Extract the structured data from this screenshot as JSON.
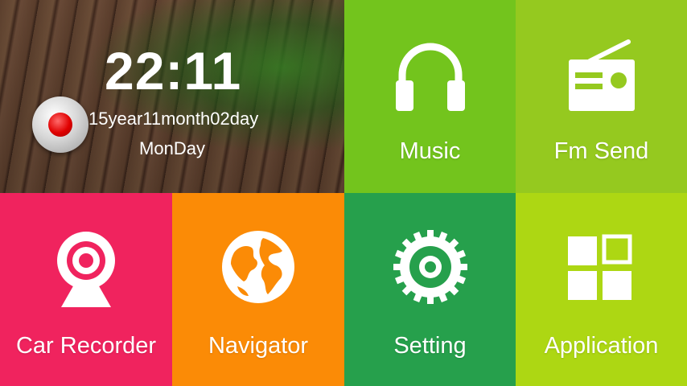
{
  "clock": {
    "time": "22:11",
    "date": "15year11month02day",
    "weekday": "MonDay"
  },
  "tiles": {
    "music": "Music",
    "fm_send": "Fm Send",
    "car_recorder": "Car Recorder",
    "navigator": "Navigator",
    "setting": "Setting",
    "application": "Application"
  },
  "colors": {
    "music": "#73c41d",
    "fm_send": "#95c91f",
    "car_recorder": "#f0235e",
    "navigator": "#fb8b06",
    "setting": "#26a04c",
    "application": "#add713",
    "record_dot": "#e00000"
  },
  "icons": {
    "record": "record-icon",
    "music": "headphones-icon",
    "fm_send": "radio-icon",
    "car_recorder": "webcam-icon",
    "navigator": "globe-icon",
    "setting": "gear-icon",
    "application": "app-grid-icon"
  }
}
